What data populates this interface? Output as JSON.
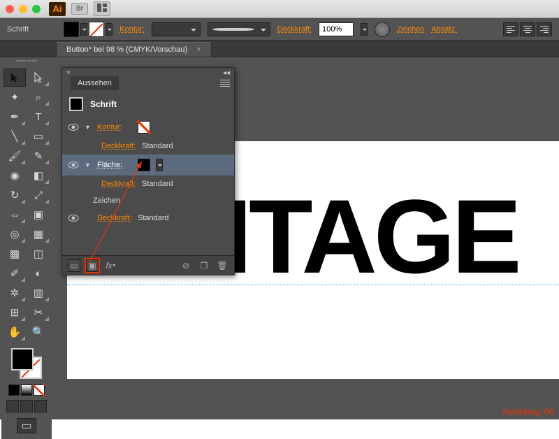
{
  "titlebar": {
    "br_btn": "Br"
  },
  "optbar": {
    "type_label": "Schrift",
    "stroke_label": "Kontur:",
    "opacity_label": "Deckkraft:",
    "opacity_value": "100%",
    "character_link": "Zeichen",
    "paragraph_link": "Absatz:"
  },
  "tabs": {
    "doc": "Button* bei 98 % (CMYK/Vorschau)"
  },
  "appearance": {
    "title": "Aussehen",
    "header": "Schrift",
    "rows": {
      "stroke": "Kontur:",
      "fill": "Fläche:",
      "char": "Zeichen",
      "opacity": "Deckkraft:",
      "standard": "Standard"
    },
    "footer_fx": "fx"
  },
  "canvas": {
    "text": "VINTAGE"
  },
  "caption": "Abbildung: 06"
}
